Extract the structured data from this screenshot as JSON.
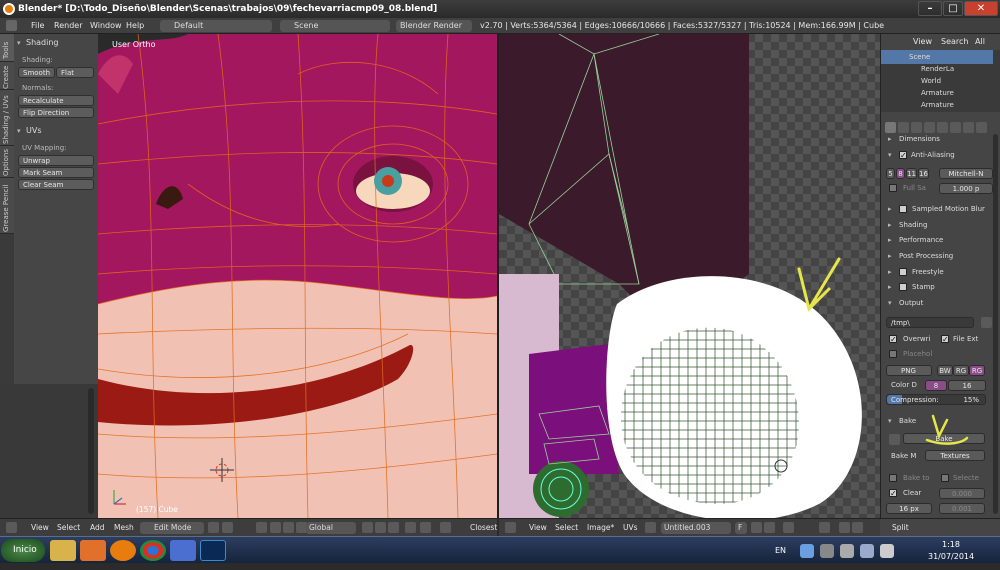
{
  "window": {
    "title": "Blender* [D:\\Todo_Diseño\\Blender\\Scenas\\trabajos\\09\\fechevarriacmp09_08.blend]",
    "minimize": "–",
    "maximize": "□",
    "close": "✕"
  },
  "topmenu": {
    "items": [
      "File",
      "Render",
      "Window",
      "Help"
    ],
    "layout": "Default",
    "scene": "Scene",
    "engine": "Blender Render",
    "stats": "v2.70 | Verts:5364/5364 | Edges:10666/10666 | Faces:5327/5327 | Tris:10524 | Mem:166.99M | Cube"
  },
  "left_tabs": [
    "Tools",
    "Create",
    "Shading / UVs",
    "Options",
    "Grease Pencil"
  ],
  "toolshelf": {
    "shading_header": "Shading",
    "shading_label": "Shading:",
    "smooth": "Smooth",
    "flat": "Flat",
    "normals_label": "Normals:",
    "recalculate": "Recalculate",
    "flip_direction": "Flip Direction",
    "uvs_header": "UVs",
    "uv_mapping_label": "UV Mapping:",
    "unwrap": "Unwrap",
    "mark_seam": "Mark Seam",
    "clear_seam": "Clear Seam"
  },
  "viewport": {
    "view_name": "User Ortho",
    "object_info": "(157) Cube"
  },
  "header3d": {
    "items": [
      "View",
      "Select",
      "Add",
      "Mesh"
    ],
    "mode": "Edit Mode",
    "orientation": "Global",
    "snap": "Closest"
  },
  "header_uv": {
    "items": [
      "View",
      "Select",
      "Image*",
      "UVs"
    ],
    "image_name": "Untitled.003",
    "fake_user": "F"
  },
  "outliner": {
    "tabs": [
      "View",
      "Search",
      "All"
    ],
    "items": [
      "Scene",
      "RenderLa",
      "World",
      "Armature",
      "Armature"
    ]
  },
  "properties": {
    "dimensions": "Dimensions",
    "anti_aliasing": "Anti-Aliasing",
    "aa_samples": [
      "5",
      "8",
      "11",
      "16"
    ],
    "aa_filter": "Mitchell-N",
    "full_sample": "Full Sa",
    "filter_size": "1.000 p",
    "sampled_motion_blur": "Sampled Motion Blur",
    "shading": "Shading",
    "performance": "Performance",
    "post_processing": "Post Processing",
    "freestyle": "Freestyle",
    "stamp": "Stamp",
    "output": "Output",
    "output_path": "/tmp\\",
    "overwrite": "Overwri",
    "file_ext": "File Ext",
    "placeholder": "Placehol",
    "format": "PNG",
    "color_modes": [
      "BW",
      "RG",
      "RG"
    ],
    "color_depth_label": "Color D",
    "color_depths": [
      "8",
      "16"
    ],
    "compression_label": "Compression:",
    "compression_value": "15%",
    "compression_fraction": 0.15,
    "bake": "Bake",
    "bake_button": "Bake",
    "bake_mode_label": "Bake M",
    "bake_mode": "Textures",
    "bake_to": "Bake to",
    "selected": "Selecte",
    "clear": "Clear",
    "value1": "0.000",
    "margin": "16 px",
    "value2": "0.001",
    "split": "Split"
  },
  "taskbar": {
    "start": "Inicio",
    "lang": "EN",
    "time": "1:18",
    "date": "31/07/2014"
  },
  "colors": {
    "mesh_magenta": "#a3175e",
    "skin": "#f1c2b3",
    "mouth": "#9b1b14",
    "wire": "#e36a1a",
    "annotation": "#e6e64a"
  }
}
